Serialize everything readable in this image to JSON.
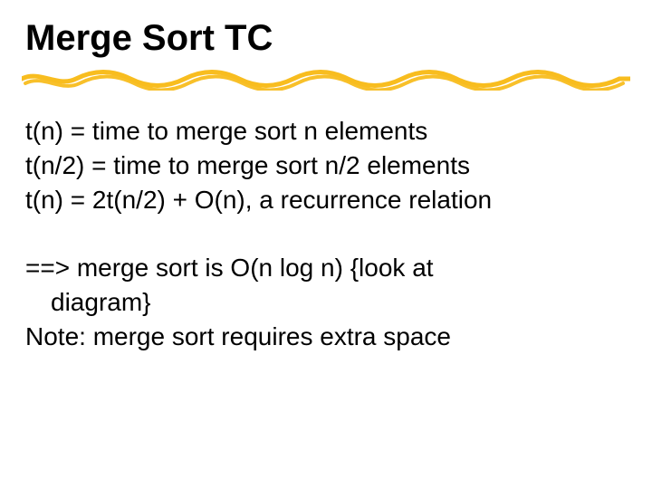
{
  "title": "Merge Sort TC",
  "lines": {
    "l1": "t(n) = time to merge sort n elements",
    "l2": "t(n/2) = time to merge sort n/2 elements",
    "l3": "t(n) =  2t(n/2) + O(n), a recurrence relation",
    "l4a": "==> merge sort is O(n log n) {look at",
    "l4b": "diagram}",
    "l5": "Note: merge sort requires extra space"
  },
  "accent_color": "#f8bd1f"
}
